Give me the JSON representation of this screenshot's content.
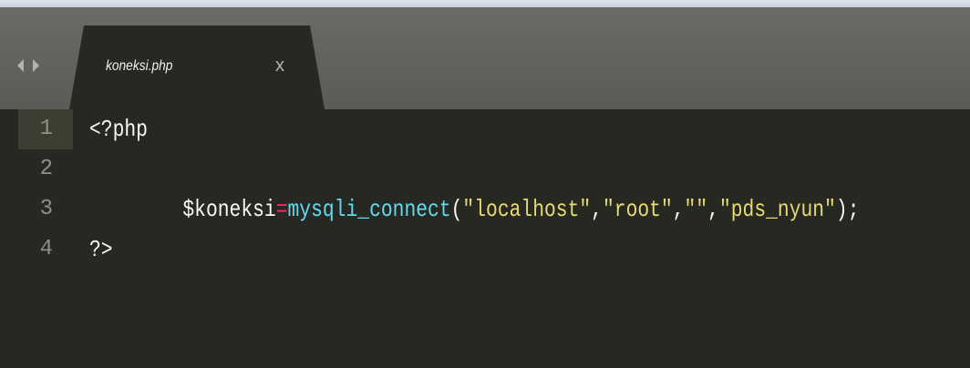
{
  "window": {
    "tab": {
      "title": "koneksi.php",
      "close_label": "x"
    },
    "nav_icon": "left-right-arrows-icon"
  },
  "editor": {
    "lines": [
      {
        "number": "1",
        "text": "<?php"
      },
      {
        "number": "2",
        "tokens": {
          "var": "$koneksi",
          "op": "=",
          "fn": "mysqli_connect",
          "open": "(",
          "s1": "\"localhost\"",
          "c1": ",",
          "s2": "\"root\"",
          "c2": ",",
          "s3": "\"\"",
          "c3": ",",
          "s4": "\"pds_nyun\"",
          "close": ");"
        }
      },
      {
        "number": "3",
        "text": ""
      },
      {
        "number": "4",
        "text": "?>"
      }
    ]
  },
  "colors": {
    "background": "#272822",
    "keyword": "#f92672",
    "function": "#66d9ef",
    "string": "#e6db74",
    "text": "#f8f8f2"
  }
}
